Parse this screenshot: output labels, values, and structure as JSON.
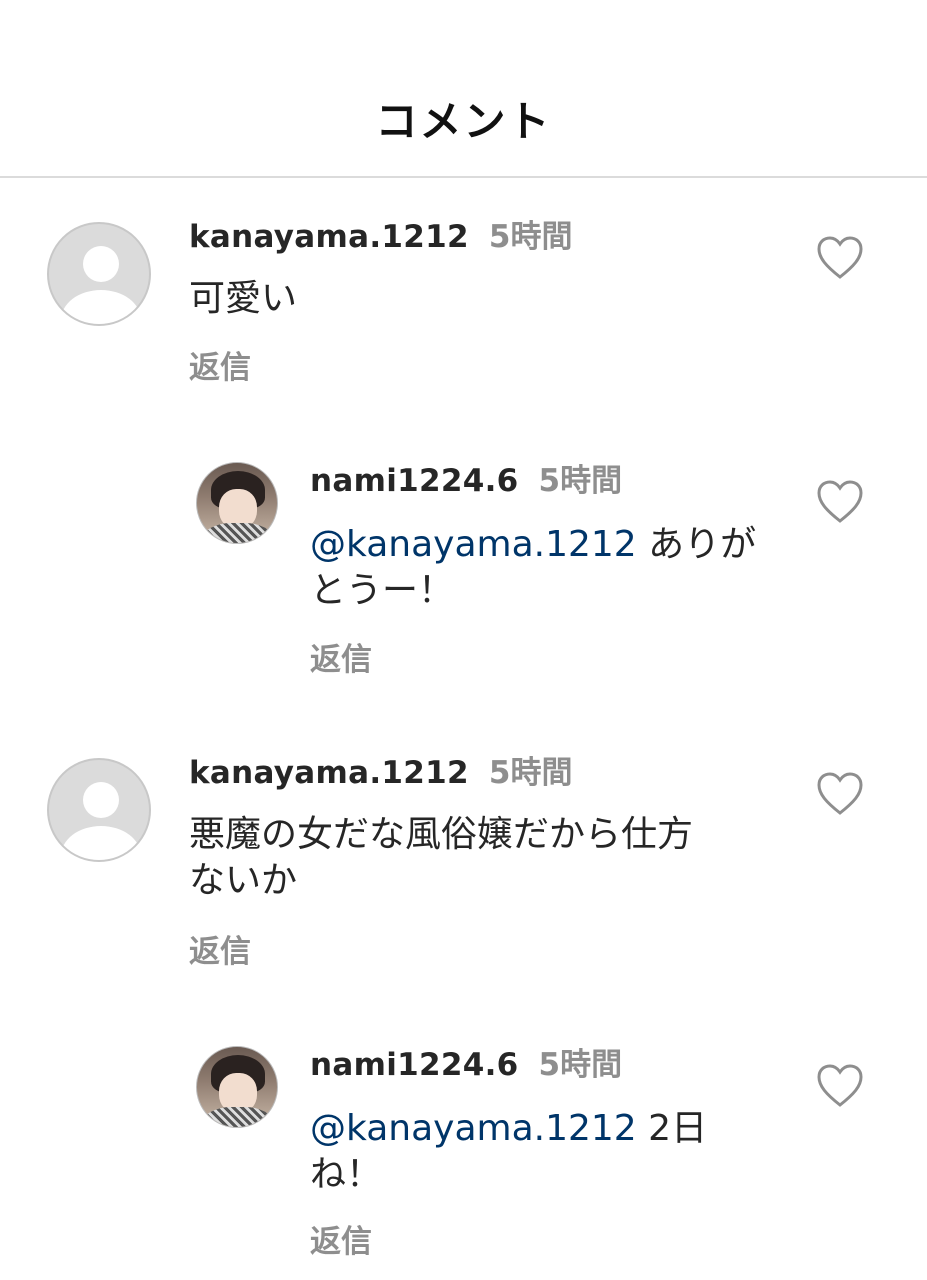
{
  "header": {
    "title": "コメント"
  },
  "comments": [
    {
      "username": "kanayama.1212",
      "time": "5時間",
      "text": "可愛い",
      "mention": "",
      "reply_label": "返信",
      "avatar": "default-avatar-icon"
    },
    {
      "username": "nami1224.6",
      "time": "5時間",
      "mention": "@kanayama.1212",
      "text_line1": " ありが",
      "text_line2": "とうー！",
      "reply_label": "返信",
      "avatar": "profile-photo"
    },
    {
      "username": "kanayama.1212",
      "time": "5時間",
      "text_line1": "悪魔の女だな風俗嬢だから仕方",
      "text_line2": "ないか",
      "reply_label": "返信",
      "avatar": "default-avatar-icon"
    },
    {
      "username": "nami1224.6",
      "time": "5時間",
      "mention": "@kanayama.1212",
      "text_line1": " 2日",
      "text_line2": "ね！",
      "reply_label": "返信",
      "avatar": "profile-photo"
    }
  ],
  "colors": {
    "mention": "#003569",
    "secondary_text": "#8e8e8e",
    "divider": "#dbdbdb"
  }
}
